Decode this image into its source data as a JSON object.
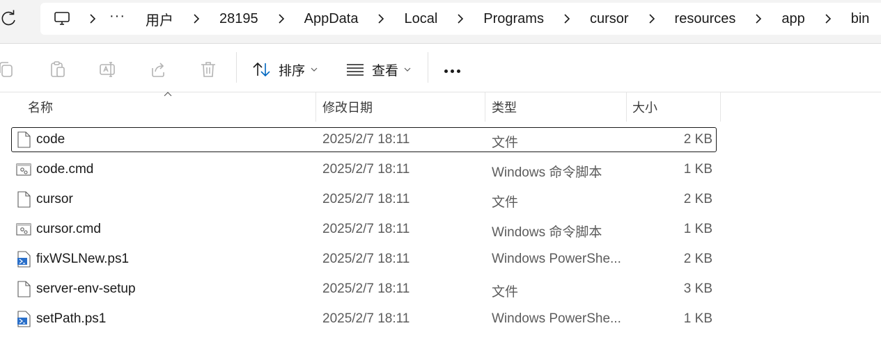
{
  "breadcrumb": {
    "ellipsis": "···",
    "items": [
      "用户",
      "28195",
      "AppData",
      "Local",
      "Programs",
      "cursor",
      "resources",
      "app",
      "bin"
    ]
  },
  "toolbar": {
    "sort_label": "排序",
    "view_label": "查看"
  },
  "columns": {
    "name": "名称",
    "modified": "修改日期",
    "type": "类型",
    "size": "大小"
  },
  "files": [
    {
      "name": "code",
      "modified": "2025/2/7 18:11",
      "type": "文件",
      "size": "2 KB",
      "icon": "file-icon"
    },
    {
      "name": "code.cmd",
      "modified": "2025/2/7 18:11",
      "type": "Windows 命令脚本",
      "size": "1 KB",
      "icon": "cmd-file-icon"
    },
    {
      "name": "cursor",
      "modified": "2025/2/7 18:11",
      "type": "文件",
      "size": "2 KB",
      "icon": "file-icon"
    },
    {
      "name": "cursor.cmd",
      "modified": "2025/2/7 18:11",
      "type": "Windows 命令脚本",
      "size": "1 KB",
      "icon": "cmd-file-icon"
    },
    {
      "name": "fixWSLNew.ps1",
      "modified": "2025/2/7 18:11",
      "type": "Windows PowerShe...",
      "size": "2 KB",
      "icon": "powershell-file-icon"
    },
    {
      "name": "server-env-setup",
      "modified": "2025/2/7 18:11",
      "type": "文件",
      "size": "3 KB",
      "icon": "file-icon"
    },
    {
      "name": "setPath.ps1",
      "modified": "2025/2/7 18:11",
      "type": "Windows PowerShe...",
      "size": "1 KB",
      "icon": "powershell-file-icon"
    }
  ],
  "selected_index": 0,
  "colors": {
    "accent": "#0067c0",
    "selection_border": "#1a1a1a",
    "disabled_icon": "#b3b3b3"
  }
}
